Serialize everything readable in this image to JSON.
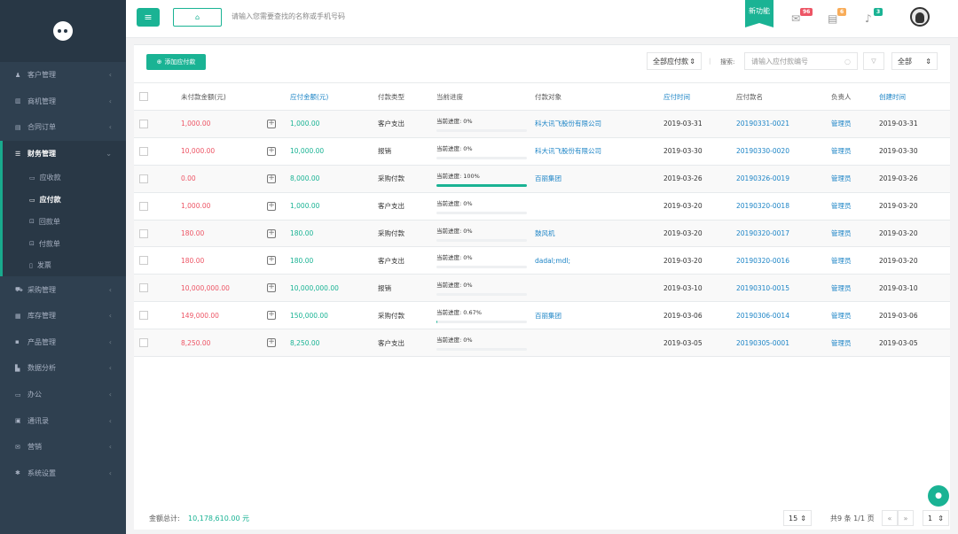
{
  "sidebar": {
    "items": [
      {
        "icon": "user-icon",
        "glyph": "♟",
        "label": "客户管理"
      },
      {
        "icon": "bank-icon",
        "glyph": "▥",
        "label": "商机管理"
      },
      {
        "icon": "contract-icon",
        "glyph": "▤",
        "label": "合同订单"
      }
    ],
    "finance": {
      "icon": "finance-icon",
      "glyph": "☰",
      "label": "财务管理"
    },
    "finance_sub": [
      {
        "glyph": "▭",
        "label": "应收款"
      },
      {
        "glyph": "▭",
        "label": "应付款"
      },
      {
        "glyph": "⊡",
        "label": "回款单"
      },
      {
        "glyph": "⊡",
        "label": "付款单"
      },
      {
        "glyph": "▯",
        "label": "发票"
      }
    ],
    "items2": [
      {
        "icon": "cart-icon",
        "glyph": "⛟",
        "label": "采购管理"
      },
      {
        "icon": "database-icon",
        "glyph": "▦",
        "label": "库存管理"
      },
      {
        "icon": "grid-icon",
        "glyph": "▪",
        "label": "产品管理"
      },
      {
        "icon": "chart-icon",
        "glyph": "▙",
        "label": "数据分析"
      },
      {
        "icon": "monitor-icon",
        "glyph": "▭",
        "label": "办公"
      },
      {
        "icon": "contacts-icon",
        "glyph": "▣",
        "label": "通讯录"
      },
      {
        "icon": "mail-icon",
        "glyph": "✉",
        "label": "营销"
      },
      {
        "icon": "gear-icon",
        "glyph": "✱",
        "label": "系统设置"
      }
    ]
  },
  "topbar": {
    "search_placeholder": "请输入您需要查找的名称或手机号码",
    "new_feature": "新功能",
    "badges": [
      {
        "value": "96",
        "color": "#ed5565"
      },
      {
        "value": "6",
        "color": "#f8ac59"
      },
      {
        "value": "3",
        "color": "#1ab394"
      }
    ]
  },
  "toolbar": {
    "add_label": "添加应付款",
    "filter_value": "全部应付款",
    "search_label": "搜索:",
    "search_placeholder": "请输入应付款编号",
    "scope_value": "全部"
  },
  "table": {
    "headers": [
      "未付款金额(元)",
      "应付金额(元)",
      "付款类型",
      "当前进度",
      "付款对象",
      "应付时间",
      "应付款名",
      "负责人",
      "创建时间"
    ],
    "progress_prefix": "当前进度:",
    "rows": [
      {
        "unpaid": "1,000.00",
        "amount": "1,000.00",
        "type": "客户支出",
        "progress": "0%",
        "pct": 0,
        "target": "科大讯飞股份有限公司",
        "due": "2019-03-31",
        "name": "20190331-0021",
        "owner": "管理员",
        "created": "2019-03-31"
      },
      {
        "unpaid": "10,000.00",
        "amount": "10,000.00",
        "type": "报销",
        "progress": "0%",
        "pct": 0,
        "target": "科大讯飞股份有限公司",
        "due": "2019-03-30",
        "name": "20190330-0020",
        "owner": "管理员",
        "created": "2019-03-30"
      },
      {
        "unpaid": "0.00",
        "amount": "8,000.00",
        "type": "采购付款",
        "progress": "100%",
        "pct": 100,
        "target": "百丽集团",
        "due": "2019-03-26",
        "name": "20190326-0019",
        "owner": "管理员",
        "created": "2019-03-26"
      },
      {
        "unpaid": "1,000.00",
        "amount": "1,000.00",
        "type": "客户支出",
        "progress": "0%",
        "pct": 0,
        "target": "",
        "due": "2019-03-20",
        "name": "20190320-0018",
        "owner": "管理员",
        "created": "2019-03-20"
      },
      {
        "unpaid": "180.00",
        "amount": "180.00",
        "type": "采购付款",
        "progress": "0%",
        "pct": 0,
        "target": "鼓风机",
        "due": "2019-03-20",
        "name": "20190320-0017",
        "owner": "管理员",
        "created": "2019-03-20"
      },
      {
        "unpaid": "180.00",
        "amount": "180.00",
        "type": "客户支出",
        "progress": "0%",
        "pct": 0,
        "target": "dadal;mdl;",
        "due": "2019-03-20",
        "name": "20190320-0016",
        "owner": "管理员",
        "created": "2019-03-20"
      },
      {
        "unpaid": "10,000,000.00",
        "amount": "10,000,000.00",
        "type": "报销",
        "progress": "0%",
        "pct": 0,
        "target": "",
        "due": "2019-03-10",
        "name": "20190310-0015",
        "owner": "管理员",
        "created": "2019-03-10"
      },
      {
        "unpaid": "149,000.00",
        "amount": "150,000.00",
        "type": "采购付款",
        "progress": "0.67%",
        "pct": 0.67,
        "target": "百丽集团",
        "due": "2019-03-06",
        "name": "20190306-0014",
        "owner": "管理员",
        "created": "2019-03-06"
      },
      {
        "unpaid": "8,250.00",
        "amount": "8,250.00",
        "type": "客户支出",
        "progress": "0%",
        "pct": 0,
        "target": "",
        "due": "2019-03-05",
        "name": "20190305-0001",
        "owner": "管理员",
        "created": "2019-03-05"
      }
    ]
  },
  "footer": {
    "total_label": "金额总计:",
    "total_value": "10,178,610.00 元",
    "page_size": "15",
    "summary": "共9 条 1/1 页",
    "prev": "«",
    "next": "»",
    "page": "1"
  }
}
